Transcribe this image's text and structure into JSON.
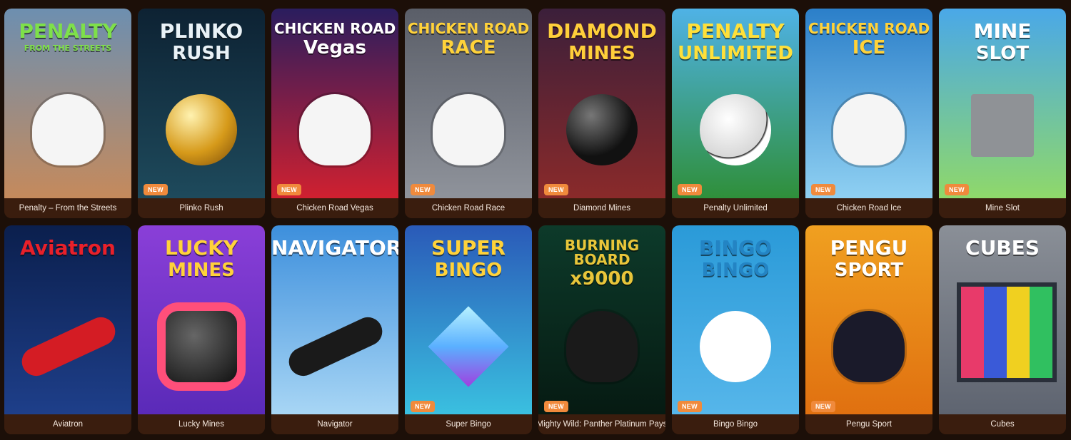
{
  "badge_label": "NEW",
  "games": [
    {
      "name": "Penalty – From the Streets",
      "art_line1": "PENALTY",
      "art_line2": "FROM THE STREETS",
      "is_new": false,
      "bg": [
        "#6d8fb0",
        "#c58a5c"
      ],
      "title_color": "#7ee04a",
      "icon": "soccer-player-icon"
    },
    {
      "name": "Plinko Rush",
      "art_line1": "PLINKO",
      "art_line2": "RUSH",
      "is_new": true,
      "bg": [
        "#0d2233",
        "#1e4a5c"
      ],
      "title_color": "#e9f2f7",
      "icon": "gold-ball-icon"
    },
    {
      "name": "Chicken Road Vegas",
      "art_line1": "CHICKEN ROAD",
      "art_line2": "Vegas",
      "is_new": true,
      "bg": [
        "#2a1d5e",
        "#d02030"
      ],
      "title_color": "#ffffff",
      "icon": "chicken-icon"
    },
    {
      "name": "Chicken Road Race",
      "art_line1": "CHICKEN ROAD",
      "art_line2": "RACE",
      "is_new": true,
      "bg": [
        "#5a5e68",
        "#8f939b"
      ],
      "title_color": "#ffd23a",
      "icon": "racing-chicken-icon"
    },
    {
      "name": "Diamond Mines",
      "art_line1": "DIAMOND",
      "art_line2": "MINES",
      "is_new": true,
      "bg": [
        "#3b1f3a",
        "#8a2a2a"
      ],
      "title_color": "#ffcf3a",
      "icon": "bomb-icon"
    },
    {
      "name": "Penalty Unlimited",
      "art_line1": "PENALTY",
      "art_line2": "UNLIMITED",
      "is_new": true,
      "bg": [
        "#4fb2e6",
        "#2f8f3a"
      ],
      "title_color": "#ffe03a",
      "icon": "soccer-ball-icon"
    },
    {
      "name": "Chicken Road Ice",
      "art_line1": "CHICKEN ROAD",
      "art_line2": "ICE",
      "is_new": true,
      "bg": [
        "#2b7fc9",
        "#8fd0f2"
      ],
      "title_color": "#ffd23a",
      "icon": "santa-chicken-icon"
    },
    {
      "name": "Mine Slot",
      "art_line1": "MINE",
      "art_line2": "SLOT",
      "is_new": true,
      "bg": [
        "#4aa8e8",
        "#8fd86a"
      ],
      "title_color": "#ffffff",
      "icon": "block-creature-icon"
    },
    {
      "name": "Aviatron",
      "art_line1": "Aviatron",
      "art_line2": "",
      "is_new": false,
      "bg": [
        "#0b1f4d",
        "#1e3f8a"
      ],
      "title_color": "#e8202a",
      "icon": "red-plane-icon"
    },
    {
      "name": "Lucky Mines",
      "art_line1": "LUCKY",
      "art_line2": "MINES",
      "is_new": false,
      "bg": [
        "#8a3fd8",
        "#5a2ab8"
      ],
      "title_color": "#ffd23a",
      "icon": "pink-bomb-icon"
    },
    {
      "name": "Navigator",
      "art_line1": "NAVIGATOR",
      "art_line2": "",
      "is_new": false,
      "bg": [
        "#3d8fdc",
        "#a8d6f5"
      ],
      "title_color": "#ffffff",
      "icon": "black-plane-icon"
    },
    {
      "name": "Super Bingo",
      "art_line1": "SUPER",
      "art_line2": "BINGO",
      "is_new": true,
      "bg": [
        "#2a5ab8",
        "#3ac0e0"
      ],
      "title_color": "#ffd23a",
      "icon": "diamond-icon"
    },
    {
      "name": "Mighty Wild: Panther Platinum Pays",
      "art_line1": "BURNING BOARD",
      "art_line2": "x9000",
      "is_new": true,
      "bg": [
        "#0d3a2a",
        "#061a12"
      ],
      "title_color": "#e8c53a",
      "icon": "panther-icon"
    },
    {
      "name": "Bingo Bingo",
      "art_line1": "BINGO",
      "art_line2": "BINGO",
      "is_new": true,
      "bg": [
        "#2a9ad8",
        "#56b6ea"
      ],
      "title_color": "#2384c4",
      "icon": "bingo-ball-icon"
    },
    {
      "name": "Pengu Sport",
      "art_line1": "PENGU",
      "art_line2": "SPORT",
      "is_new": true,
      "bg": [
        "#f0a020",
        "#e07010"
      ],
      "title_color": "#ffffff",
      "icon": "penguin-icon"
    },
    {
      "name": "Cubes",
      "art_line1": "CUBES",
      "art_line2": "",
      "is_new": false,
      "bg": [
        "#8a8f97",
        "#5e6470"
      ],
      "title_color": "#ffffff",
      "icon": "cube-grid-icon"
    }
  ]
}
